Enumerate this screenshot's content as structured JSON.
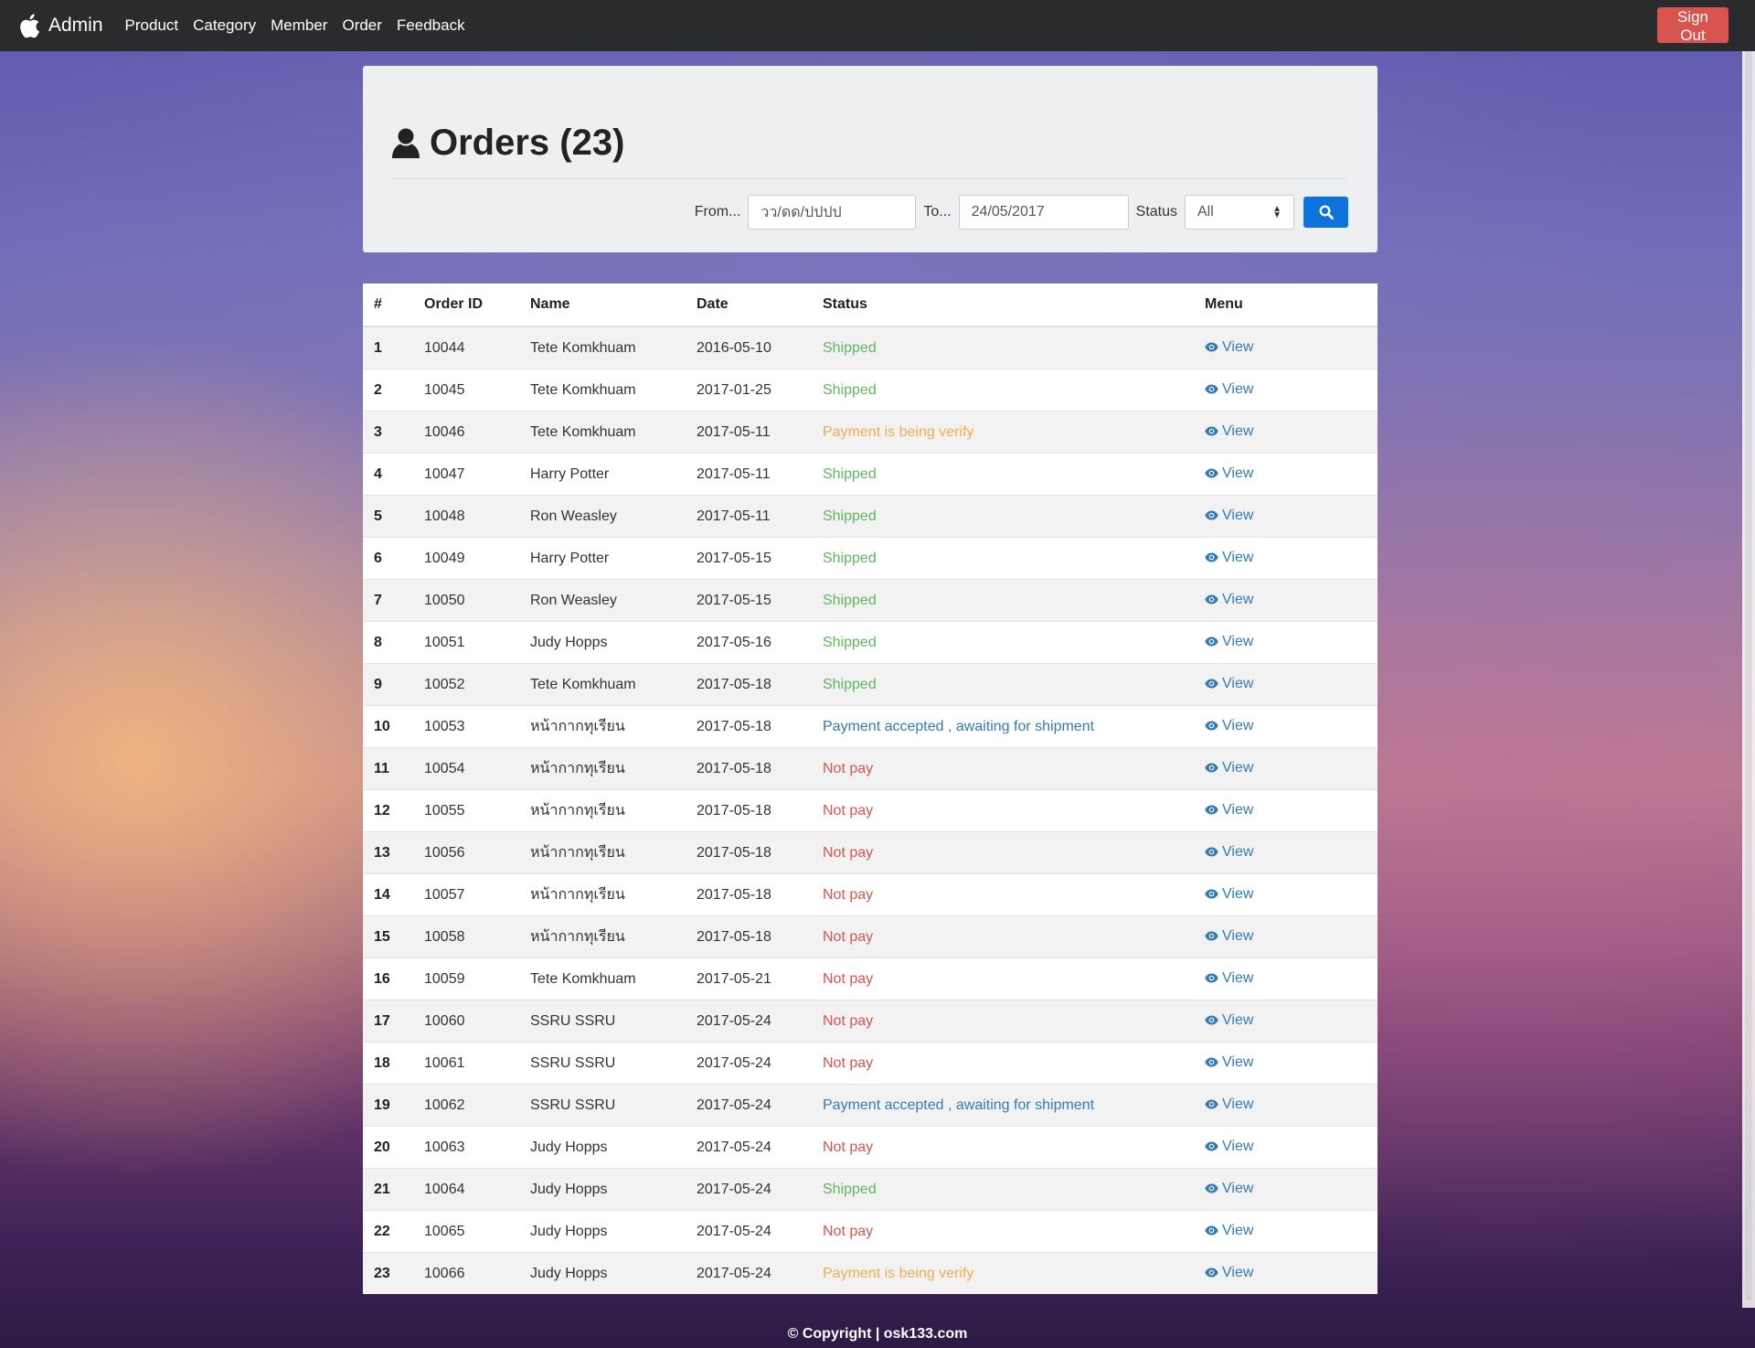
{
  "navbar": {
    "brand": "Admin",
    "brand_icon": "apple-icon",
    "links": [
      "Product",
      "Category",
      "Member",
      "Order",
      "Feedback"
    ],
    "signout_label": "Sign Out"
  },
  "header": {
    "title": "Orders (23)",
    "title_icon": "user-icon"
  },
  "filters": {
    "from_label": "From...",
    "from_value": "วว/ดด/ปปปป",
    "to_label": "To...",
    "to_value": "24/05/2017",
    "status_label": "Status",
    "status_value": "All",
    "search_icon": "search-icon"
  },
  "table": {
    "headers": [
      "#",
      "Order ID",
      "Name",
      "Date",
      "Status",
      "Menu"
    ],
    "view_label": "View",
    "rows": [
      {
        "n": "1",
        "id": "10044",
        "name": "Tete Komkhuam",
        "date": "2016-05-10",
        "status": "Shipped",
        "kind": "shipped"
      },
      {
        "n": "2",
        "id": "10045",
        "name": "Tete Komkhuam",
        "date": "2017-01-25",
        "status": "Shipped",
        "kind": "shipped"
      },
      {
        "n": "3",
        "id": "10046",
        "name": "Tete Komkhuam",
        "date": "2017-05-11",
        "status": "Payment is being verify",
        "kind": "verify"
      },
      {
        "n": "4",
        "id": "10047",
        "name": "Harry Potter",
        "date": "2017-05-11",
        "status": "Shipped",
        "kind": "shipped"
      },
      {
        "n": "5",
        "id": "10048",
        "name": "Ron Weasley",
        "date": "2017-05-11",
        "status": "Shipped",
        "kind": "shipped"
      },
      {
        "n": "6",
        "id": "10049",
        "name": "Harry Potter",
        "date": "2017-05-15",
        "status": "Shipped",
        "kind": "shipped"
      },
      {
        "n": "7",
        "id": "10050",
        "name": "Ron Weasley",
        "date": "2017-05-15",
        "status": "Shipped",
        "kind": "shipped"
      },
      {
        "n": "8",
        "id": "10051",
        "name": "Judy Hopps",
        "date": "2017-05-16",
        "status": "Shipped",
        "kind": "shipped"
      },
      {
        "n": "9",
        "id": "10052",
        "name": "Tete Komkhuam",
        "date": "2017-05-18",
        "status": "Shipped",
        "kind": "shipped"
      },
      {
        "n": "10",
        "id": "10053",
        "name": "หน้ากากทุเรียน",
        "date": "2017-05-18",
        "status": "Payment accepted , awaiting for shipment",
        "kind": "accepted"
      },
      {
        "n": "11",
        "id": "10054",
        "name": "หน้ากากทุเรียน",
        "date": "2017-05-18",
        "status": "Not pay",
        "kind": "notpay"
      },
      {
        "n": "12",
        "id": "10055",
        "name": "หน้ากากทุเรียน",
        "date": "2017-05-18",
        "status": "Not pay",
        "kind": "notpay"
      },
      {
        "n": "13",
        "id": "10056",
        "name": "หน้ากากทุเรียน",
        "date": "2017-05-18",
        "status": "Not pay",
        "kind": "notpay"
      },
      {
        "n": "14",
        "id": "10057",
        "name": "หน้ากากทุเรียน",
        "date": "2017-05-18",
        "status": "Not pay",
        "kind": "notpay"
      },
      {
        "n": "15",
        "id": "10058",
        "name": "หน้ากากทุเรียน",
        "date": "2017-05-18",
        "status": "Not pay",
        "kind": "notpay"
      },
      {
        "n": "16",
        "id": "10059",
        "name": "Tete Komkhuam",
        "date": "2017-05-21",
        "status": "Not pay",
        "kind": "notpay"
      },
      {
        "n": "17",
        "id": "10060",
        "name": "SSRU SSRU",
        "date": "2017-05-24",
        "status": "Not pay",
        "kind": "notpay"
      },
      {
        "n": "18",
        "id": "10061",
        "name": "SSRU SSRU",
        "date": "2017-05-24",
        "status": "Not pay",
        "kind": "notpay"
      },
      {
        "n": "19",
        "id": "10062",
        "name": "SSRU SSRU",
        "date": "2017-05-24",
        "status": "Payment accepted , awaiting for shipment",
        "kind": "accepted"
      },
      {
        "n": "20",
        "id": "10063",
        "name": "Judy Hopps",
        "date": "2017-05-24",
        "status": "Not pay",
        "kind": "notpay"
      },
      {
        "n": "21",
        "id": "10064",
        "name": "Judy Hopps",
        "date": "2017-05-24",
        "status": "Shipped",
        "kind": "shipped"
      },
      {
        "n": "22",
        "id": "10065",
        "name": "Judy Hopps",
        "date": "2017-05-24",
        "status": "Not pay",
        "kind": "notpay"
      },
      {
        "n": "23",
        "id": "10066",
        "name": "Judy Hopps",
        "date": "2017-05-24",
        "status": "Payment is being verify",
        "kind": "verify"
      }
    ]
  },
  "colors": {
    "shipped": "#5cb85c",
    "verify": "#f0ad4e",
    "accepted": "#337ab7",
    "notpay": "#d9534f",
    "signout": "#d9534f",
    "search": "#0b73d9"
  },
  "footer": "© Copyright | osk133.com"
}
